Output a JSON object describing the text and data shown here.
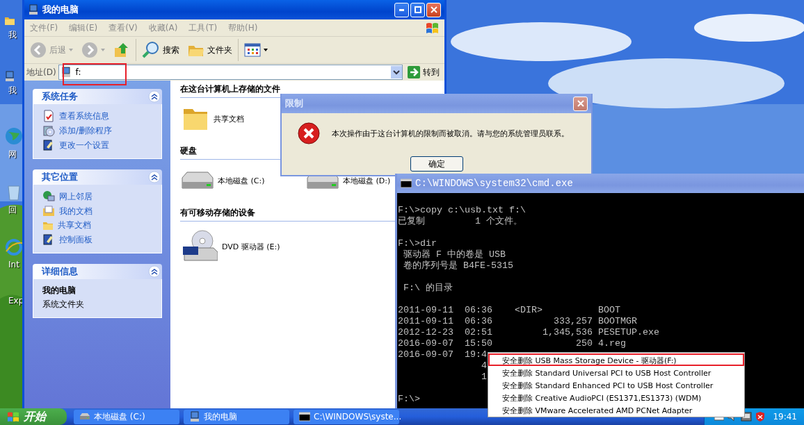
{
  "desktop": {
    "icons": [
      {
        "label": "我",
        "kind": "folder"
      },
      {
        "label": "我",
        "kind": "computer"
      },
      {
        "label": "网",
        "kind": "globe"
      },
      {
        "label": "回",
        "kind": "bin"
      },
      {
        "label": "Int",
        "kind": "browser"
      },
      {
        "label": "Exp",
        "kind": "none"
      }
    ]
  },
  "explorer": {
    "title": "我的电脑",
    "menu": [
      "文件(F)",
      "编辑(E)",
      "查看(V)",
      "收藏(A)",
      "工具(T)",
      "帮助(H)"
    ],
    "toolbar": {
      "back": "后退",
      "search": "搜索",
      "folders": "文件夹"
    },
    "address": {
      "label": "地址(D)",
      "value": "f:",
      "annotated": true,
      "go": "转到"
    },
    "panels": [
      {
        "title": "系统任务",
        "kind": "links",
        "items": [
          {
            "label": "查看系统信息",
            "kind": "info"
          },
          {
            "label": "添加/删除程序",
            "kind": "programs"
          },
          {
            "label": "更改一个设置",
            "kind": "settings"
          }
        ]
      },
      {
        "title": "其它位置",
        "kind": "links",
        "items": [
          {
            "label": "网上邻居",
            "kind": "network"
          },
          {
            "label": "我的文档",
            "kind": "documents"
          },
          {
            "label": "共享文档",
            "kind": "folder"
          },
          {
            "label": "控制面板",
            "kind": "settings"
          }
        ]
      },
      {
        "title": "详细信息",
        "kind": "details",
        "name": "我的电脑",
        "subtitle": "系统文件夹"
      }
    ],
    "sections": [
      {
        "title": "在这台计算机上存储的文件",
        "items": [
          {
            "label": "共享文档",
            "kind": "folder"
          }
        ]
      },
      {
        "title": "硬盘",
        "items": [
          {
            "label": "本地磁盘 (C:)",
            "kind": "drive"
          },
          {
            "label": "本地磁盘 (D:)",
            "kind": "drive"
          }
        ]
      },
      {
        "title": "有可移动存储的设备",
        "items": [
          {
            "label": "DVD 驱动器 (E:)",
            "kind": "dvd"
          }
        ]
      }
    ]
  },
  "dialog": {
    "title": "限制",
    "message": "本次操作由于这台计算机的限制而被取消。请与您的系统管理员联系。",
    "button": "确定"
  },
  "console": {
    "title": "C:\\WINDOWS\\system32\\cmd.exe",
    "blocks": [
      [
        "F:\\>copy c:\\usb.txt f:\\",
        "已复制         1 个文件。"
      ],
      [
        "F:\\>dir",
        " 驱动器 F 中的卷是 USB",
        " 卷的序列号是 B4FE-5315"
      ],
      [
        " F:\\ 的目录"
      ],
      [
        "2011-09-11  06:36    <DIR>          BOOT",
        "2011-09-11  06:36           333,257 BOOTMGR",
        "2012-12-23  02:51         1,345,536 PESETUP.exe",
        "2016-09-07  15:50               250 4.reg",
        "2016-09-07  19:4",
        "               4",
        "               1"
      ],
      [
        "F:\\>"
      ]
    ]
  },
  "context_menu": {
    "items": [
      {
        "label": "安全删除 USB Mass Storage Device - 驱动器(F:)",
        "annotated": true
      },
      {
        "label": "安全删除 Standard Universal PCI to USB Host Controller",
        "annotated": false
      },
      {
        "label": "安全删除 Standard Enhanced PCI to USB Host Controller",
        "annotated": false
      },
      {
        "label": "安全删除 Creative AudioPCI (ES1371,ES1373) (WDM)",
        "annotated": false
      },
      {
        "label": "安全删除 VMware Accelerated AMD PCNet Adapter",
        "annotated": false
      }
    ]
  },
  "taskbar": {
    "start": "开始",
    "tasks": [
      {
        "label": "本地磁盘 (C:)",
        "kind": "drive",
        "selected": false
      },
      {
        "label": "我的电脑",
        "kind": "computer",
        "selected": false
      },
      {
        "label": "C:\\WINDOWS\\syste...",
        "kind": "console",
        "selected": false
      }
    ],
    "clock": "19:41"
  }
}
